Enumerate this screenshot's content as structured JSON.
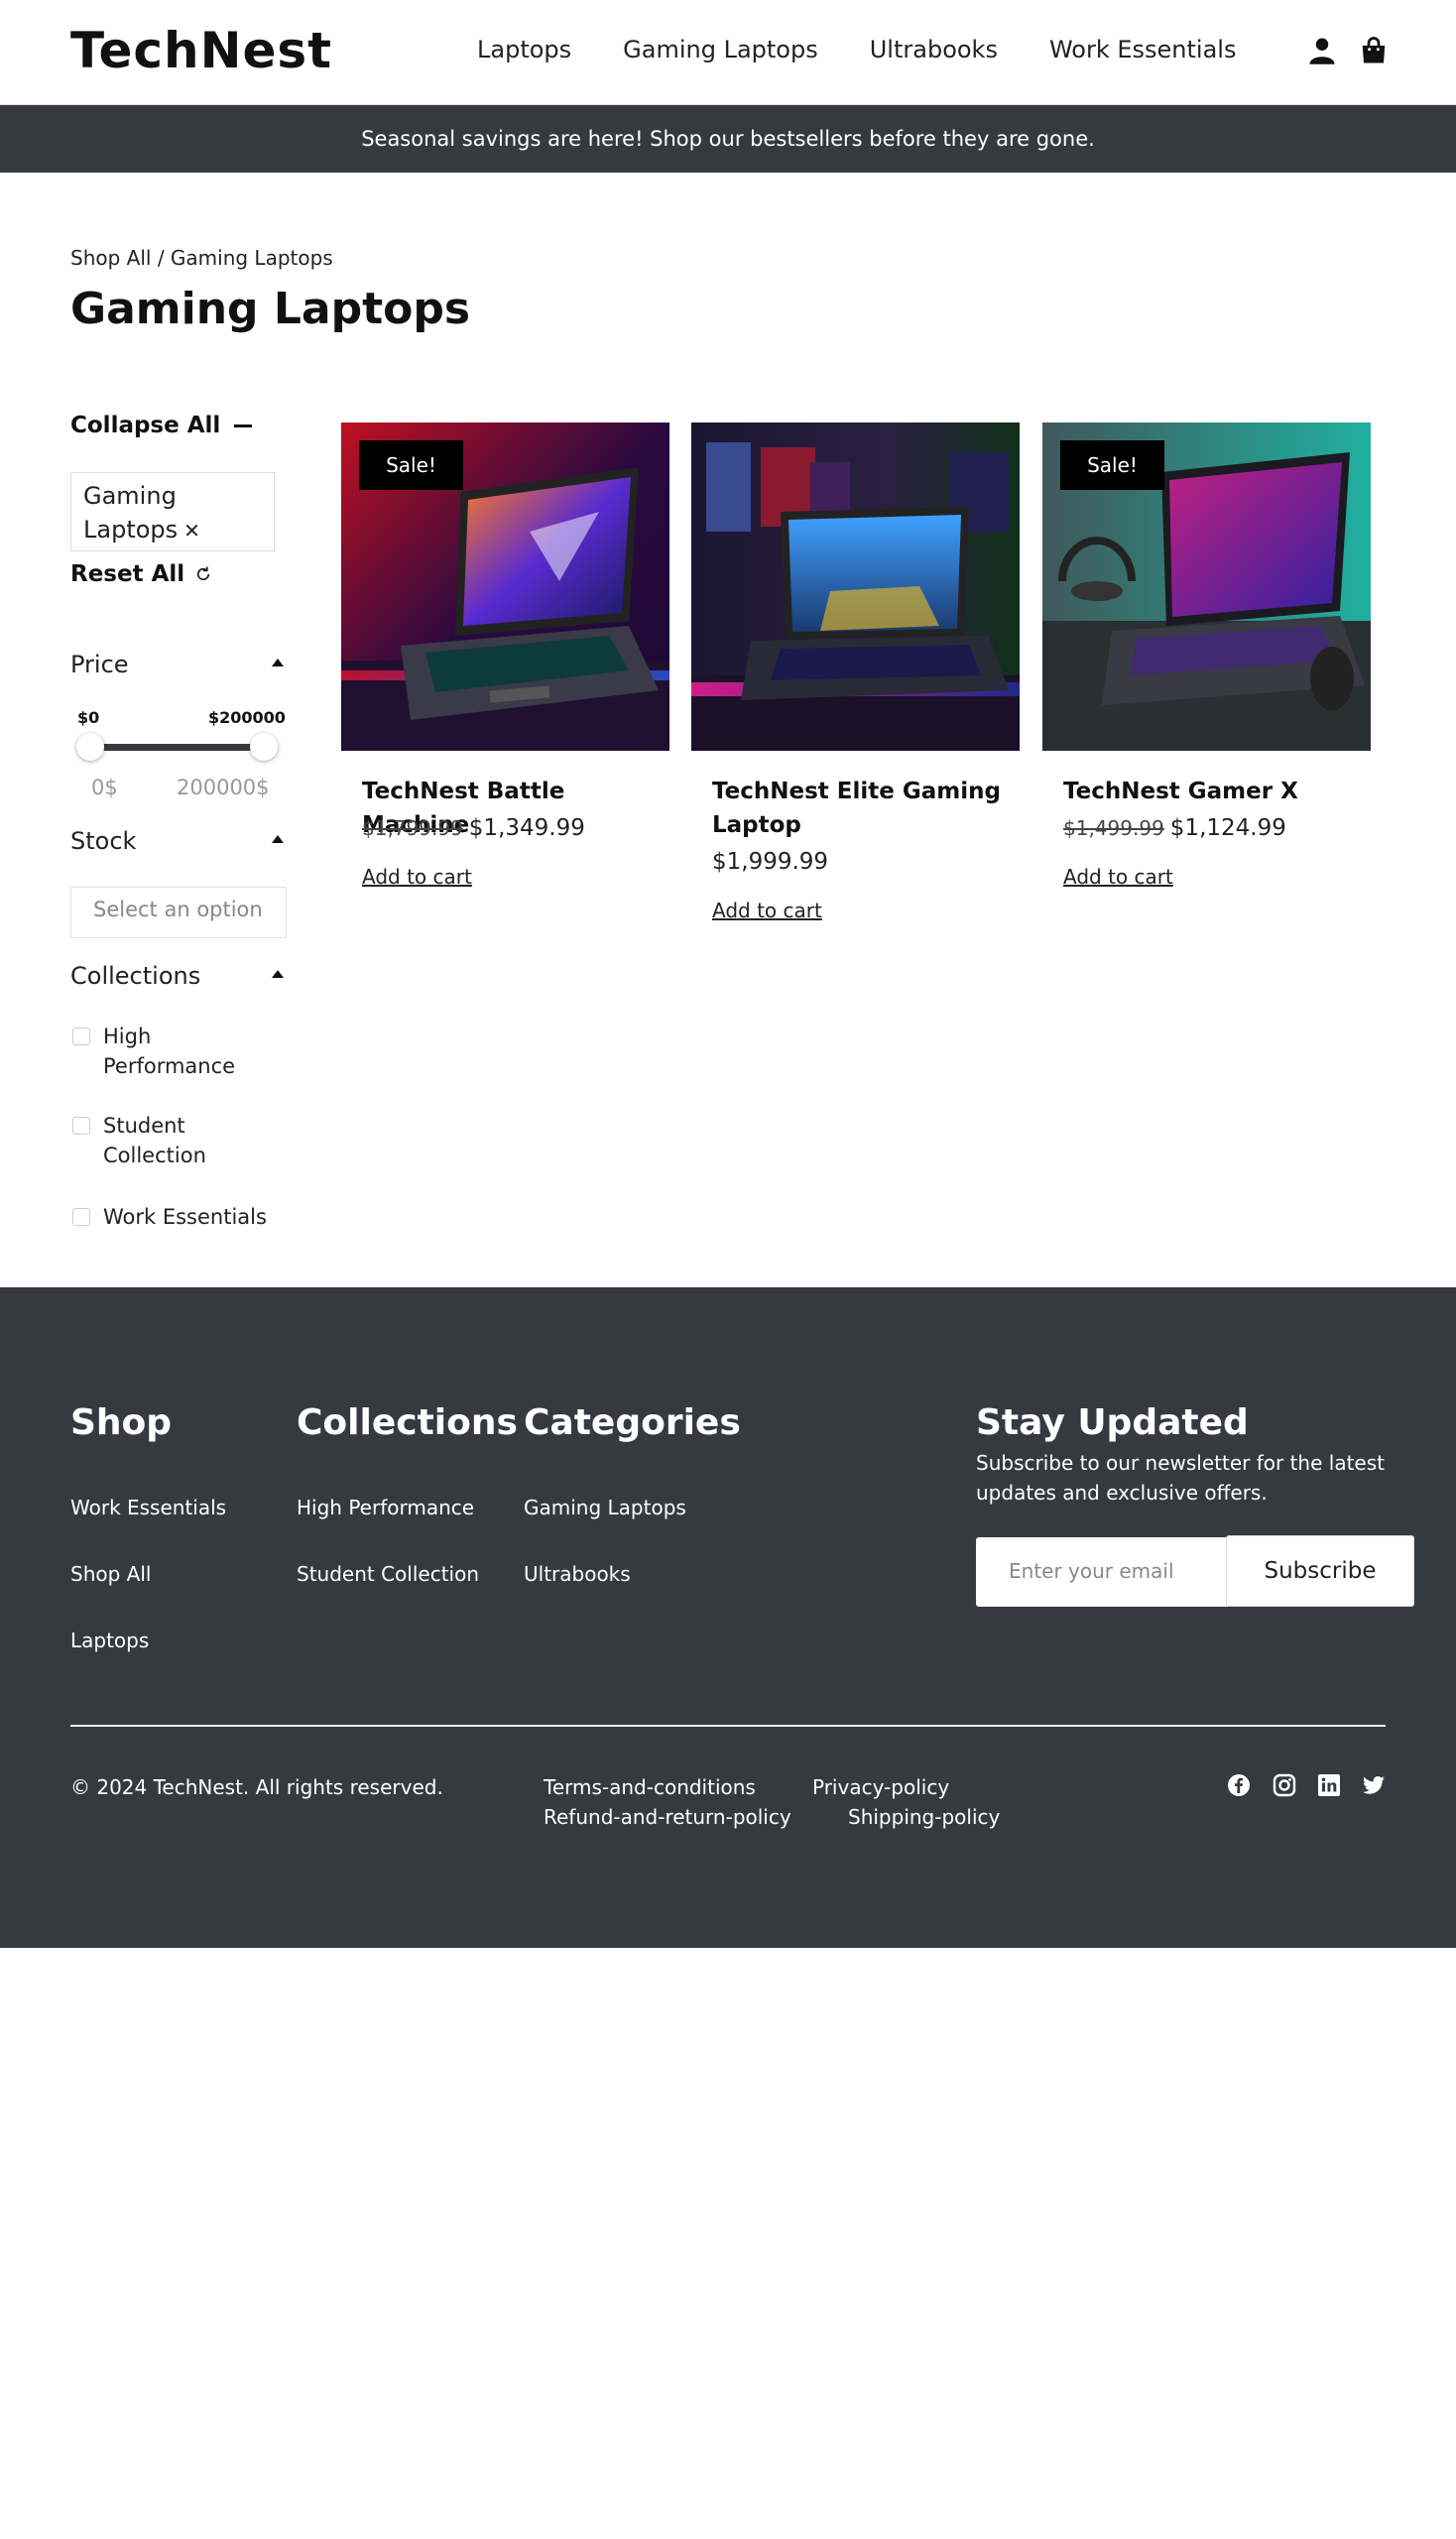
{
  "header": {
    "logo": "TechNest",
    "nav": [
      "Laptops",
      "Gaming Laptops",
      "Ultrabooks",
      "Work Essentials"
    ],
    "icons": [
      "user-icon",
      "bag-icon"
    ]
  },
  "announcement": "Seasonal savings are here! Shop our bestsellers before they are gone.",
  "breadcrumb": "Shop All / Gaming Laptops",
  "page_title": "Gaming Laptops",
  "sidebar": {
    "collapse_all": "Collapse All",
    "active_filter": "Gaming Laptops",
    "reset_all": "Reset All",
    "price": {
      "label": "Price",
      "min_label": "$0",
      "max_label": "$200000",
      "min_placeholder": "0$",
      "max_placeholder": "200000$"
    },
    "stock": {
      "label": "Stock",
      "placeholder": "Select an option"
    },
    "collections": {
      "label": "Collections",
      "items": [
        "High Performance",
        "Student Collection",
        "Work Essentials"
      ]
    }
  },
  "products": [
    {
      "name": "TechNest Battle Machine",
      "sale_badge": "Sale!",
      "old_price": "$1,799.99",
      "price": "$1,349.99",
      "cta": "Add to cart"
    },
    {
      "name": "TechNest Elite Gaming Laptop",
      "sale_badge": "",
      "old_price": "",
      "price": "$1,999.99",
      "cta": "Add to cart"
    },
    {
      "name": "TechNest Gamer X",
      "sale_badge": "Sale!",
      "old_price": "$1,499.99",
      "price": "$1,124.99",
      "cta": "Add to cart"
    }
  ],
  "footer": {
    "shop": {
      "title": "Shop",
      "links": [
        "Work Essentials",
        "Shop All",
        "Laptops"
      ]
    },
    "collections": {
      "title": "Collections",
      "links": [
        "High Performance",
        "Student Collection"
      ]
    },
    "categories": {
      "title": "Categories",
      "links": [
        "Gaming Laptops",
        "Ultrabooks"
      ]
    },
    "newsletter": {
      "title": "Stay Updated",
      "text": "Subscribe to our newsletter for the latest updates and exclusive offers.",
      "email_placeholder": "Enter your email",
      "button": "Subscribe"
    },
    "copyright": "© 2024 TechNest. All rights reserved.",
    "legal": [
      "Terms-and-conditions",
      "Privacy-policy",
      "Refund-and-return-policy",
      "Shipping-policy"
    ],
    "social": [
      "facebook-icon",
      "instagram-icon",
      "linkedin-icon",
      "twitter-icon"
    ]
  },
  "colors": {
    "dark": "#363a40",
    "black": "#000000",
    "white": "#ffffff"
  }
}
